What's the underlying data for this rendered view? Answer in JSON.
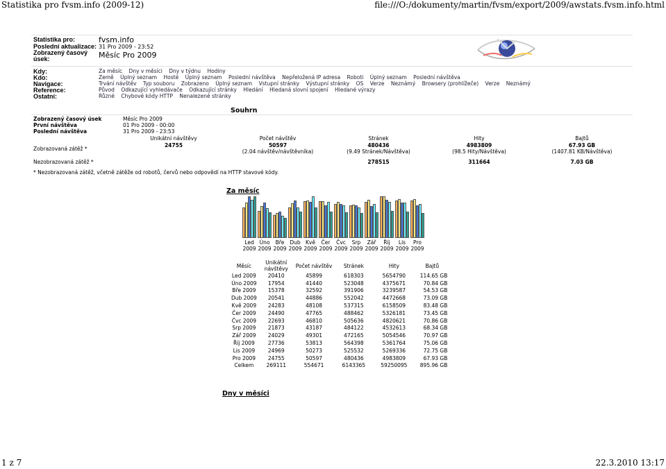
{
  "browser": {
    "title": "Statistika pro fvsm.info (2009-12)",
    "url": "file:///O:/dokumenty/martin/fvsm/export/2009/awstats.fvsm.info.html",
    "page_counter": "1 z 7",
    "timestamp": "22.3.2010 13:17"
  },
  "info": {
    "stats_for_label": "Statistika pro:",
    "stats_for_value": "fvsm.info",
    "last_update_label": "Poslední aktualizace:",
    "last_update_value": "31 Pro 2009 - 23:52",
    "period_label": "Zobrazený časový úsek:",
    "period_value": "Měsíc Pro 2009"
  },
  "nav": {
    "kdy_label": "Kdy:",
    "kdy": [
      "Za měsíc",
      "Dny v měsíci",
      "Dny v týdnu",
      "Hodiny"
    ],
    "kdo_label": "Kdo:",
    "kdo": [
      "Země",
      "Úplný seznam",
      "Hosté",
      "Úplný seznam",
      "Poslední návštěva",
      "Nepřeložená IP adresa",
      "Roboti",
      "Úplný seznam",
      "Poslední návštěva"
    ],
    "navigace_label": "Navigace:",
    "navigace": [
      "Trvání návštěv",
      "Typ souboru",
      "Zobrazeno",
      "Úplný seznam",
      "Vstupní stránky",
      "Výstupní stránky",
      "OS",
      "Verze",
      "Neznámý",
      "Browsery (prohlížeče)",
      "Verze",
      "Neznámý"
    ],
    "reference_label": "Reference:",
    "reference": [
      "Původ",
      "Odkazující vyhledávače",
      "Odkazující stránky",
      "Hledání",
      "Hledaná slovní spojení",
      "Hledané výrazy"
    ],
    "ostatni_label": "Ostatní:",
    "ostatni": [
      "Různé",
      "Chybové kódy HTTP",
      "Nenalezené stránky"
    ]
  },
  "summary": {
    "title": "Souhrn",
    "period_label": "Zobrazený časový úsek",
    "period_value": "Měsíc Pro 2009",
    "first_visit_label": "První návštěva",
    "first_visit_value": "01 Pro 2009 - 00:00",
    "last_visit_label": "Poslední návštěva",
    "last_visit_value": "31 Pro 2009 - 23:53",
    "col_unique": "Unikátní návštěvy",
    "col_visits": "Počet návštěv",
    "col_pages": "Stránek",
    "col_hits": "Hity",
    "col_bytes": "Bajtů",
    "viewed_label": "Zobrazovaná zátěž *",
    "viewed_unique": "24755",
    "viewed_visits": "50597",
    "viewed_visits_sub": "(2.04 návštěv/návštěvníka)",
    "viewed_pages": "480436",
    "viewed_pages_sub": "(9.49 Stránek/Návštěva)",
    "viewed_hits": "4983809",
    "viewed_hits_sub": "(98.5 Hity/Návštěva)",
    "viewed_bytes": "67.93 GB",
    "viewed_bytes_sub": "(1407.81 KB/Návštěva)",
    "notviewed_label": "Nezobrazovaná zátěž *",
    "notviewed_pages": "278515",
    "notviewed_hits": "311664",
    "notviewed_bytes": "7.03 GB",
    "footnote": "* Nezobrazovaná zátěž, včetně zátěže od robotů, červů nebo odpovědí na HTTP stavové kódy."
  },
  "monthly": {
    "title": "Za měsíc",
    "headers": [
      "Měsíc",
      "Unikátní návštěvy",
      "Počet návštěv",
      "Stránek",
      "Hity",
      "Bajtů"
    ],
    "rows": [
      [
        "Led 2009",
        "20410",
        "45899",
        "618303",
        "5654790",
        "114.65 GB"
      ],
      [
        "Úno 2009",
        "17954",
        "41440",
        "523048",
        "4375671",
        "70.84 GB"
      ],
      [
        "Bře 2009",
        "15378",
        "32592",
        "391906",
        "3239587",
        "54.53 GB"
      ],
      [
        "Dub 2009",
        "20541",
        "44886",
        "552042",
        "4472668",
        "73.09 GB"
      ],
      [
        "Kvě 2009",
        "24283",
        "48108",
        "537315",
        "6158509",
        "83.48 GB"
      ],
      [
        "Čer 2009",
        "24490",
        "47765",
        "488462",
        "5326181",
        "73.45 GB"
      ],
      [
        "Čvc 2009",
        "22693",
        "46810",
        "505636",
        "4820621",
        "70.86 GB"
      ],
      [
        "Srp 2009",
        "21873",
        "43187",
        "484122",
        "4532613",
        "68.34 GB"
      ],
      [
        "Zář 2009",
        "24029",
        "49301",
        "472165",
        "5054546",
        "70.97 GB"
      ],
      [
        "Říj 2009",
        "27736",
        "53813",
        "564398",
        "5361764",
        "75.06 GB"
      ],
      [
        "Lis 2009",
        "24969",
        "50273",
        "525532",
        "5269336",
        "72.75 GB"
      ],
      [
        "Pro 2009",
        "24755",
        "50597",
        "480436",
        "4983809",
        "67.93 GB"
      ]
    ],
    "total": [
      "Celkem",
      "269111",
      "554671",
      "6143365",
      "59250095",
      "895.96 GB"
    ]
  },
  "chart_data": {
    "type": "bar",
    "categories": [
      "Led 2009",
      "Úno 2009",
      "Bře 2009",
      "Dub 2009",
      "Kvě 2009",
      "Čer 2009",
      "Čvc 2009",
      "Srp 2009",
      "Zář 2009",
      "Říj 2009",
      "Lis 2009",
      "Pro 2009"
    ],
    "month_labels": [
      [
        "Led",
        "2009"
      ],
      [
        "Úno",
        "2009"
      ],
      [
        "Bře",
        "2009"
      ],
      [
        "Dub",
        "2009"
      ],
      [
        "Kvě",
        "2009"
      ],
      [
        "Čer",
        "2009"
      ],
      [
        "Čvc",
        "2009"
      ],
      [
        "Srp",
        "2009"
      ],
      [
        "Zář",
        "2009"
      ],
      [
        "Říj",
        "2009"
      ],
      [
        "Lis",
        "2009"
      ],
      [
        "Pro",
        "2009"
      ]
    ],
    "series": [
      {
        "values": [
          20410,
          17954,
          15378,
          20541,
          24283,
          24490,
          22693,
          21873,
          24029,
          27736,
          24969,
          24755
        ],
        "color": "#ffb055"
      },
      {
        "values": [
          45899,
          41440,
          32592,
          44886,
          48108,
          47765,
          46810,
          43187,
          49301,
          53813,
          50273,
          50597
        ],
        "color": "#f8e880"
      },
      {
        "values": [
          618303,
          523048,
          391906,
          552042,
          537315,
          488462,
          505636,
          484122,
          472165,
          564398,
          525532,
          480436
        ],
        "color": "#4477dd"
      },
      {
        "values": [
          5654790,
          4375671,
          3239587,
          4472668,
          6158509,
          5326181,
          4820621,
          4532613,
          5054546,
          5361764,
          5269336,
          4983809
        ],
        "color": "#66f0ff"
      },
      {
        "values": [
          114.65,
          70.84,
          54.53,
          73.09,
          83.48,
          73.45,
          70.86,
          68.34,
          70.97,
          75.06,
          72.75,
          67.93
        ],
        "color": "#2ea495"
      }
    ],
    "title": "Za měsíc"
  },
  "daily": {
    "title": "Dny v měsíci"
  }
}
